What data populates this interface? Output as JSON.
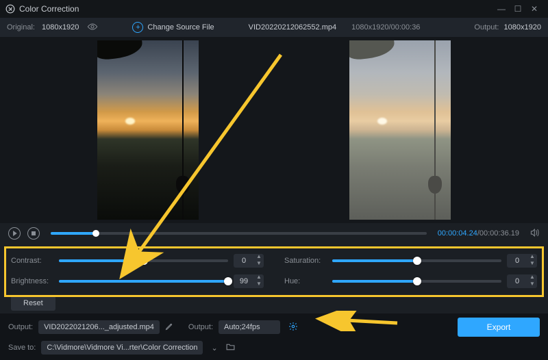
{
  "window": {
    "title": "Color Correction"
  },
  "info": {
    "original_label": "Original:",
    "original_value": "1080x1920",
    "change_source_label": "Change Source File",
    "filename": "VID20220212062552.mp4",
    "src_dims": "1080x1920/00:00:36",
    "output_label": "Output:",
    "output_value": "1080x1920"
  },
  "transport": {
    "current": "00:00:04.24",
    "total": "/00:00:36.19",
    "progress_pct": 12
  },
  "adjust": {
    "contrast": {
      "label": "Contrast:",
      "value": "0",
      "pct": 50
    },
    "saturation": {
      "label": "Saturation:",
      "value": "0",
      "pct": 50
    },
    "brightness": {
      "label": "Brightness:",
      "value": "99",
      "pct": 100
    },
    "hue": {
      "label": "Hue:",
      "value": "0",
      "pct": 50
    },
    "reset_label": "Reset"
  },
  "bottom": {
    "output_name_label": "Output:",
    "output_name": "VID2022021206..._adjusted.mp4",
    "fmt_label": "Output:",
    "fmt_value": "Auto;24fps",
    "export_label": "Export",
    "save_label": "Save to:",
    "save_path": "C:\\Vidmore\\Vidmore Vi...rter\\Color Correction"
  }
}
